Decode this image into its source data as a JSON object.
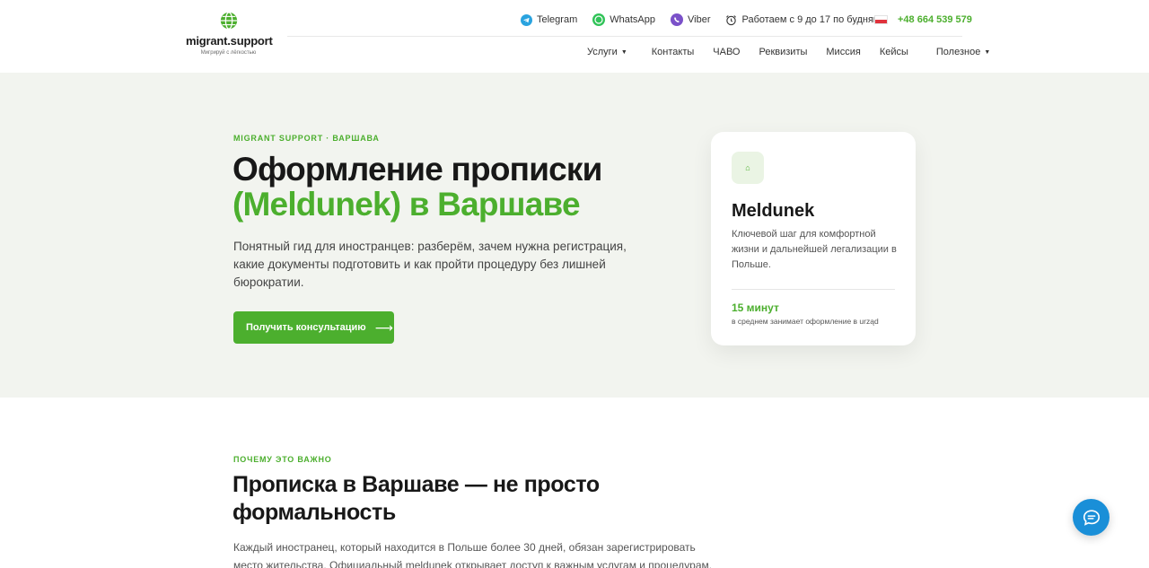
{
  "logo": {
    "name": "migrant.support",
    "tagline": "Мигрируй с лёгкостью"
  },
  "topbar": {
    "telegram": "Telegram",
    "whatsapp": "WhatsApp",
    "viber": "Viber",
    "hours": "Работаем с 9 до 17 по будням",
    "phone": "+48 664 539 579"
  },
  "nav": {
    "items": [
      "Услуги",
      "Контакты",
      "ЧАВО",
      "Реквизиты",
      "Миссия",
      "Кейсы",
      "Полезное"
    ]
  },
  "hero": {
    "eyebrow": "MIGRANT SUPPORT · ВАРШАВА",
    "title_line1": "Оформление прописки",
    "title_line2": "(Meldunek) в Варшаве",
    "text": "Понятный гид для иностранцев: разберём, зачем нужна регистрация, какие документы подготовить и как пройти процедуру без лишней бюрократии.",
    "cta": "Получить консультацию",
    "cta_arrow": "⟶"
  },
  "card": {
    "icon_glyph": "⌂",
    "title": "Meldunek",
    "text": "Ключевой шаг для комфортной жизни и дальнейшей легализации в Польше.",
    "stat": "15 минут",
    "stat_note": "в среднем занимает оформление в urząd"
  },
  "section": {
    "eyebrow": "ПОЧЕМУ ЭТО ВАЖНО",
    "title": "Прописка в Варшаве — не просто формальность",
    "text": "Каждый иностранец, который находится в Польше более 30 дней, обязан зарегистрировать место жительства. Официальный meldunek открывает доступ к важным услугам и процедурам."
  },
  "colors": {
    "accent": "#4caf2e",
    "hero_bg": "#f2f4ef",
    "chat": "#1a8fd8"
  }
}
